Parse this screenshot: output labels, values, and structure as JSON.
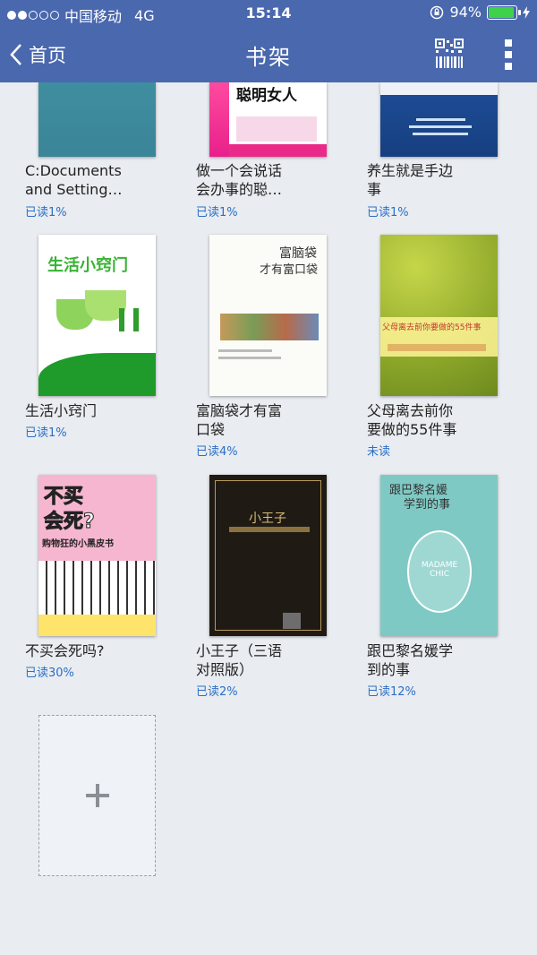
{
  "status_bar": {
    "carrier": "中国移动",
    "network": "4G",
    "time": "15:14",
    "battery_percent": "94%",
    "battery_level": 0.94
  },
  "nav": {
    "back_label": "首页",
    "title": "书架"
  },
  "colors": {
    "nav_bg": "#4a68ae",
    "progress_text": "#2a6fc7",
    "page_bg": "#e9ecf0"
  },
  "books": [
    {
      "title_line1": "C:Documents",
      "title_line2": "and Setting…",
      "status": "已读1%"
    },
    {
      "title_line1": "做一个会说话",
      "title_line2": "会办事的聪…",
      "status": "已读1%",
      "cover_text": "聪明女人"
    },
    {
      "title_line1": "养生就是手边",
      "title_line2": "事",
      "status": "已读1%"
    },
    {
      "title_line1": "生活小窍门",
      "title_line2": "",
      "status": "已读1%",
      "cover_text": "生活小窍门"
    },
    {
      "title_line1": "富脑袋才有富",
      "title_line2": "口袋",
      "status": "已读4%",
      "cover_text_1": "富脑袋",
      "cover_text_2": "才有富口袋"
    },
    {
      "title_line1": "父母离去前你",
      "title_line2": "要做的55件事",
      "status": "未读",
      "cover_text": "父母离去前你要做的55件事"
    },
    {
      "title_line1": "不买会死吗?",
      "title_line2": "",
      "status": "已读30%",
      "cover_text_1": "不买",
      "cover_text_2": "会死?",
      "cover_text_3": "购物狂的小黑皮书"
    },
    {
      "title_line1": "小王子（三语",
      "title_line2": "对照版）",
      "status": "已读2%",
      "cover_text": "小王子"
    },
    {
      "title_line1": "跟巴黎名媛学",
      "title_line2": "到的事",
      "status": "已读12%",
      "cover_text_1": "跟巴黎名媛",
      "cover_text_2": "学到的事",
      "cover_text_3": "MADAME CHIC"
    }
  ],
  "add_button": {
    "icon": "plus-icon"
  }
}
